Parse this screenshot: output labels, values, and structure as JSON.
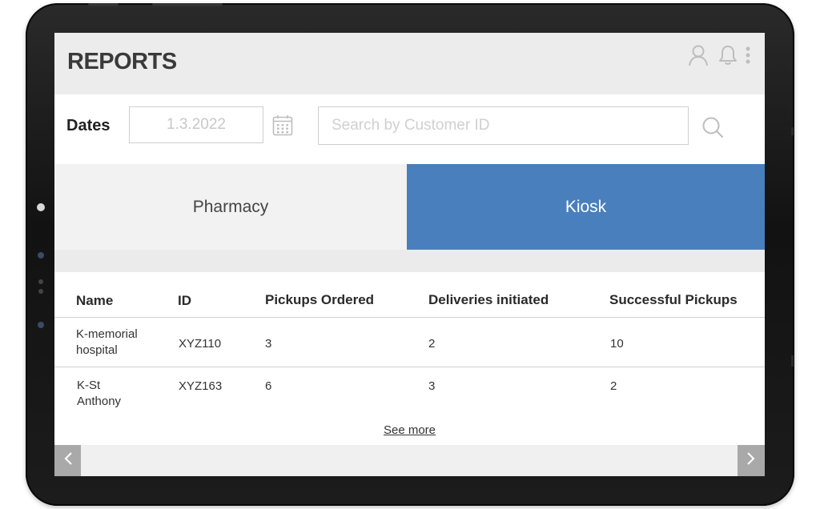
{
  "header": {
    "title": "REPORTS",
    "icons": [
      "user-icon",
      "bell-icon",
      "more-vertical-icon"
    ]
  },
  "filters": {
    "dates_label": "Dates",
    "date_value": "1.3.2022",
    "search_placeholder": "Search by Customer ID",
    "icons": [
      "calendar-icon",
      "search-icon"
    ]
  },
  "tabs": {
    "pharmacy": "Pharmacy",
    "kiosk": "Kiosk",
    "active": "Kiosk"
  },
  "table": {
    "columns": [
      "Name",
      "ID",
      "Pickups Ordered",
      "Deliveries initiated",
      "Successful Pickups"
    ],
    "rows": [
      {
        "name_line1": "K-memorial",
        "name_line2": "hospital",
        "id": "XYZ110",
        "pickups_ordered": "3",
        "deliveries_initiated": "2",
        "successful_pickups": "10"
      },
      {
        "name_line1": "K-St",
        "name_line2": "Anthony",
        "id": "XYZ163",
        "pickups_ordered": "6",
        "deliveries_initiated": "3",
        "successful_pickups": "2"
      }
    ],
    "see_more": "See more"
  },
  "footer": {
    "icons": [
      "chevron-left-icon",
      "chevron-right-icon"
    ]
  },
  "colors": {
    "accent": "#4a7fbd",
    "header_bg": "#ececec",
    "nav_button": "#a9a9a9"
  }
}
